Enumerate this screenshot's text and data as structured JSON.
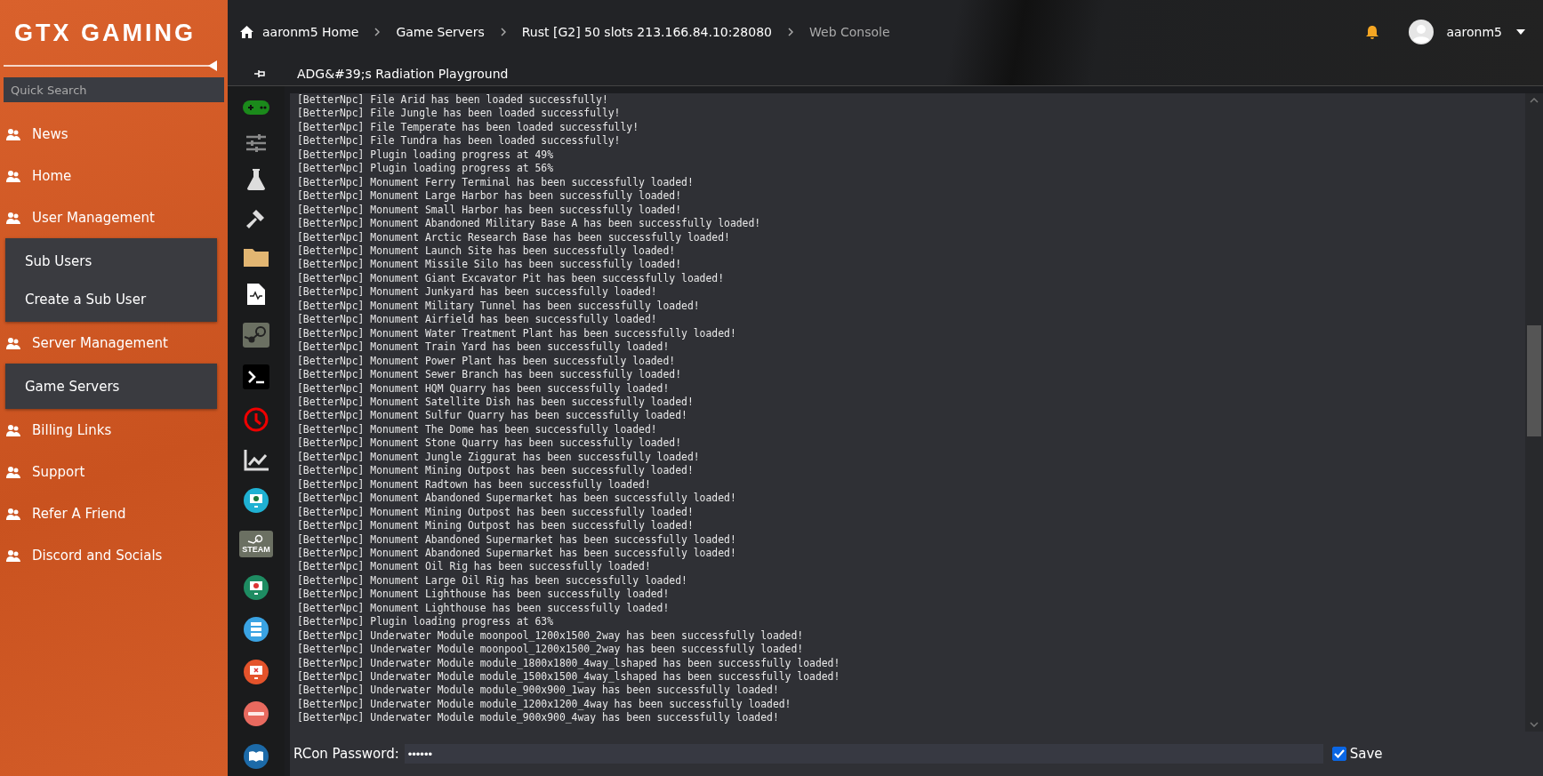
{
  "sidebar": {
    "logo": "GTX GAMING",
    "search": {
      "placeholder": "Quick Search"
    },
    "items": [
      {
        "label": "News"
      },
      {
        "label": "Home"
      },
      {
        "label": "User Management",
        "children": [
          {
            "label": "Sub Users"
          },
          {
            "label": "Create a Sub User"
          }
        ]
      },
      {
        "label": "Server Management",
        "children": [
          {
            "label": "Game Servers"
          }
        ]
      },
      {
        "label": "Billing Links"
      },
      {
        "label": "Support"
      },
      {
        "label": "Refer A Friend"
      },
      {
        "label": "Discord and Socials"
      }
    ]
  },
  "breadcrumb": [
    "aaronm5 Home",
    "Game Servers",
    "Rust [G2] 50 slots 213.166.84.10:28080",
    "Web Console"
  ],
  "user": {
    "name": "aaronm5"
  },
  "server_title": "ADG&#39;s Radiation Playground",
  "tool_bar": {
    "steam_badge": "STEAM"
  },
  "console": {
    "lines": [
      "[BetterNpc] File Arid has been loaded successfully!",
      "[BetterNpc] File Jungle has been loaded successfully!",
      "[BetterNpc] File Temperate has been loaded successfully!",
      "[BetterNpc] File Tundra has been loaded successfully!",
      "[BetterNpc] Plugin loading progress at 49%",
      "[BetterNpc] Plugin loading progress at 56%",
      "[BetterNpc] Monument Ferry Terminal has been successfully loaded!",
      "[BetterNpc] Monument Large Harbor has been successfully loaded!",
      "[BetterNpc] Monument Small Harbor has been successfully loaded!",
      "[BetterNpc] Monument Abandoned Military Base A has been successfully loaded!",
      "[BetterNpc] Monument Arctic Research Base has been successfully loaded!",
      "[BetterNpc] Monument Launch Site has been successfully loaded!",
      "[BetterNpc] Monument Missile Silo has been successfully loaded!",
      "[BetterNpc] Monument Giant Excavator Pit has been successfully loaded!",
      "[BetterNpc] Monument Junkyard has been successfully loaded!",
      "[BetterNpc] Monument Military Tunnel has been successfully loaded!",
      "[BetterNpc] Monument Airfield has been successfully loaded!",
      "[BetterNpc] Monument Water Treatment Plant has been successfully loaded!",
      "[BetterNpc] Monument Train Yard has been successfully loaded!",
      "[BetterNpc] Monument Power Plant has been successfully loaded!",
      "[BetterNpc] Monument Sewer Branch has been successfully loaded!",
      "[BetterNpc] Monument HQM Quarry has been successfully loaded!",
      "[BetterNpc] Monument Satellite Dish has been successfully loaded!",
      "[BetterNpc] Monument Sulfur Quarry has been successfully loaded!",
      "[BetterNpc] Monument The Dome has been successfully loaded!",
      "[BetterNpc] Monument Stone Quarry has been successfully loaded!",
      "[BetterNpc] Monument Jungle Ziggurat has been successfully loaded!",
      "[BetterNpc] Monument Mining Outpost has been successfully loaded!",
      "[BetterNpc] Monument Radtown has been successfully loaded!",
      "[BetterNpc] Monument Abandoned Supermarket has been successfully loaded!",
      "[BetterNpc] Monument Mining Outpost has been successfully loaded!",
      "[BetterNpc] Monument Mining Outpost has been successfully loaded!",
      "[BetterNpc] Monument Abandoned Supermarket has been successfully loaded!",
      "[BetterNpc] Monument Abandoned Supermarket has been successfully loaded!",
      "[BetterNpc] Monument Oil Rig has been successfully loaded!",
      "[BetterNpc] Monument Large Oil Rig has been successfully loaded!",
      "[BetterNpc] Monument Lighthouse has been successfully loaded!",
      "[BetterNpc] Monument Lighthouse has been successfully loaded!",
      "[BetterNpc] Plugin loading progress at 63%",
      "[BetterNpc] Underwater Module moonpool_1200x1500_2way has been successfully loaded!",
      "[BetterNpc] Underwater Module moonpool_1200x1500_2way has been successfully loaded!",
      "[BetterNpc] Underwater Module module_1800x1800_4way_lshaped has been successfully loaded!",
      "[BetterNpc] Underwater Module module_1500x1500_4way_lshaped has been successfully loaded!",
      "[BetterNpc] Underwater Module module_900x900_1way has been successfully loaded!",
      "[BetterNpc] Underwater Module module_1200x1200_4way has been successfully loaded!",
      "[BetterNpc] Underwater Module module_900x900_4way has been successfully loaded!"
    ]
  },
  "rcon": {
    "label": "RCon Password:",
    "value": "••••••",
    "save": {
      "label": "Save",
      "checked": true
    }
  }
}
